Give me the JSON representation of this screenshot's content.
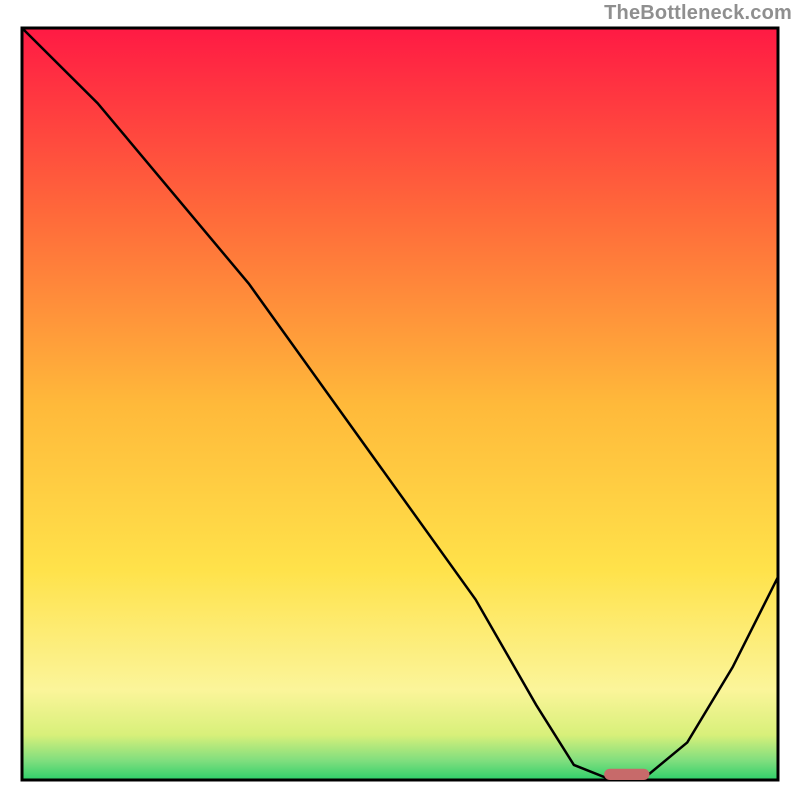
{
  "watermark": "TheBottleneck.com",
  "chart_data": {
    "type": "line",
    "title": "",
    "xlabel": "",
    "ylabel": "",
    "xlim": [
      0,
      100
    ],
    "ylim": [
      0,
      100
    ],
    "x": [
      0,
      10,
      20,
      25,
      30,
      40,
      50,
      60,
      68,
      73,
      78,
      82,
      88,
      94,
      100
    ],
    "values": [
      100,
      90,
      78,
      72,
      66,
      52,
      38,
      24,
      10,
      2,
      0,
      0,
      5,
      15,
      27
    ],
    "marker": {
      "x": 80,
      "y": 0,
      "width": 6,
      "height": 1.5,
      "color": "#c76a6a"
    },
    "gradient_stops": [
      {
        "offset": 0.0,
        "color": "#ff1a44"
      },
      {
        "offset": 0.25,
        "color": "#ff6a3a"
      },
      {
        "offset": 0.5,
        "color": "#ffb93a"
      },
      {
        "offset": 0.72,
        "color": "#ffe24a"
      },
      {
        "offset": 0.88,
        "color": "#fbf59a"
      },
      {
        "offset": 0.94,
        "color": "#d8f07a"
      },
      {
        "offset": 0.975,
        "color": "#7ede7e"
      },
      {
        "offset": 1.0,
        "color": "#2ecf6a"
      }
    ],
    "annotations": []
  }
}
